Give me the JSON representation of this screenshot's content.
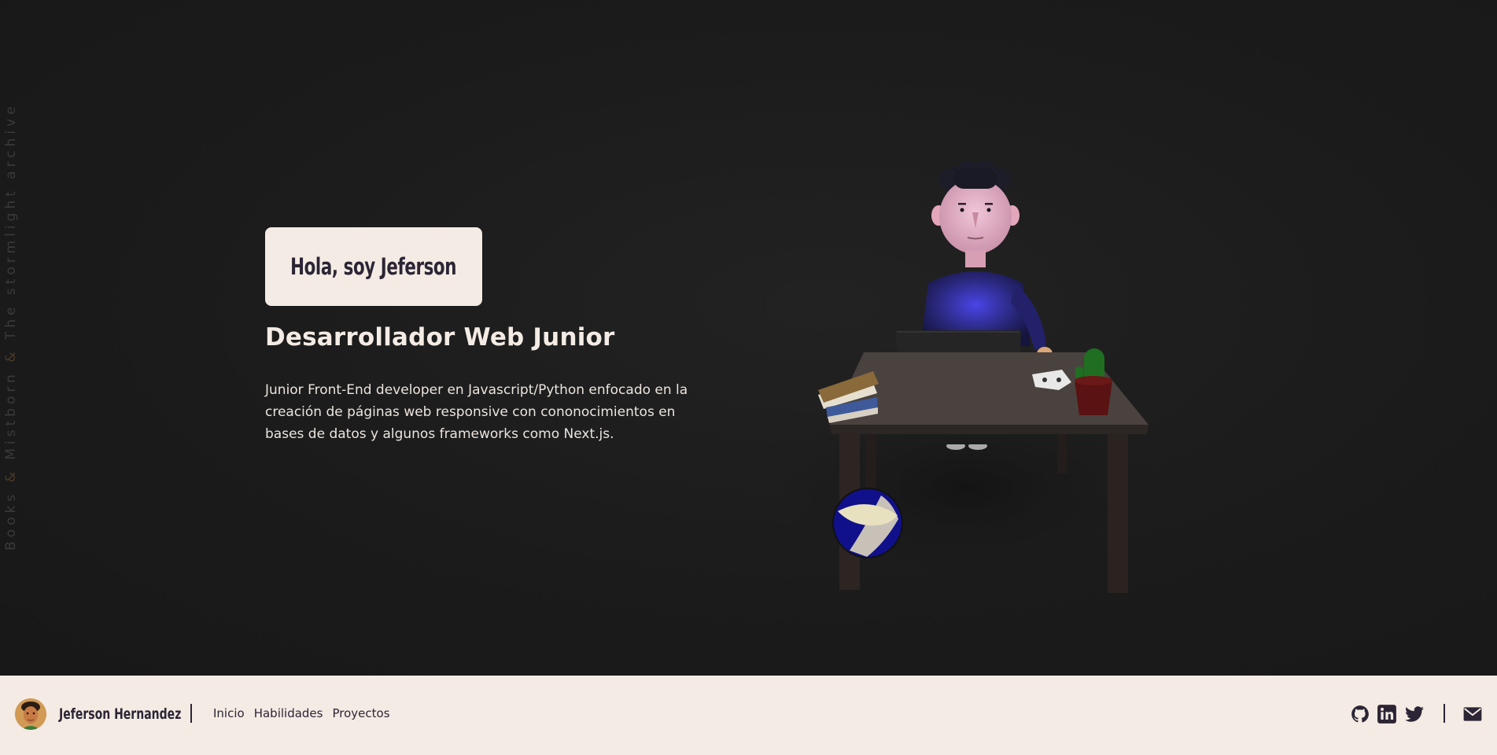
{
  "side_text": {
    "part1": "Books ",
    "amp1": "&",
    "part2": " Mistborn ",
    "amp2": "&",
    "part3": " The stormlight archive"
  },
  "hero": {
    "greeting": "Hola, soy Jeferson",
    "role": "Desarrollador Web Junior",
    "description": "Junior Front-End developer en Javascript/Python enfocado en la creación de páginas web responsive con cononocimientos en bases de datos y algunos frameworks como Next.js."
  },
  "footer": {
    "brand": "Jeferson Hernandez",
    "nav": [
      "Inicio",
      "Habilidades",
      "Proyectos"
    ],
    "social_icons": [
      "github-icon",
      "linkedin-icon",
      "twitter-icon",
      "mail-icon"
    ]
  },
  "colors": {
    "background": "#1b1b1b",
    "cream": "#f4ebe4",
    "text_dark": "#2c2535"
  }
}
